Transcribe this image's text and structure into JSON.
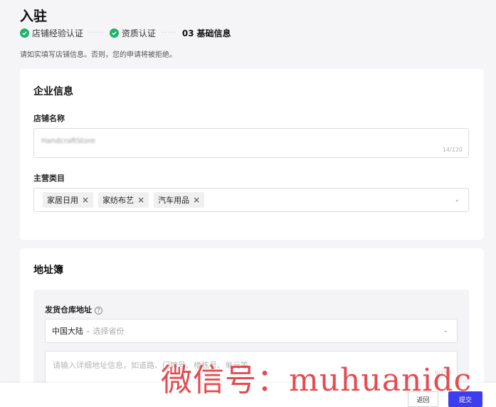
{
  "page": {
    "title": "入驻",
    "notice": "请如实填写店铺信息。否则，您的申请将被拒绝。"
  },
  "stepper": {
    "step1": "店铺经验认证",
    "step2": "资质认证",
    "step3_num": "03",
    "step3": "基础信息",
    "separator": "·····"
  },
  "company": {
    "title": "企业信息",
    "store_name_label": "店铺名称",
    "store_name_value": "HandcraftStore",
    "store_name_counter": "14/120",
    "category_label": "主营类目",
    "categories": [
      "家居日用",
      "家纺布艺",
      "汽车用品"
    ],
    "tag_remove": "×",
    "chevron": "⌄"
  },
  "address": {
    "title": "地址簿",
    "warehouse_label": "发货仓库地址",
    "help": "?",
    "country": "中国大陆",
    "dash": "–",
    "province_placeholder": "选择省份",
    "detail_placeholder": "请输入详细地址信息，如道路、门牌号、楼栋号、单元等",
    "detail_counter": "0/150",
    "chevron": "⌄"
  },
  "footer": {
    "back_label": "返回",
    "submit_label": "提交"
  },
  "watermark": "微信号：muhuanidc",
  "colors": {
    "accent": "#3d3df0",
    "success": "#1db36b",
    "watermark": "#e0343a"
  }
}
